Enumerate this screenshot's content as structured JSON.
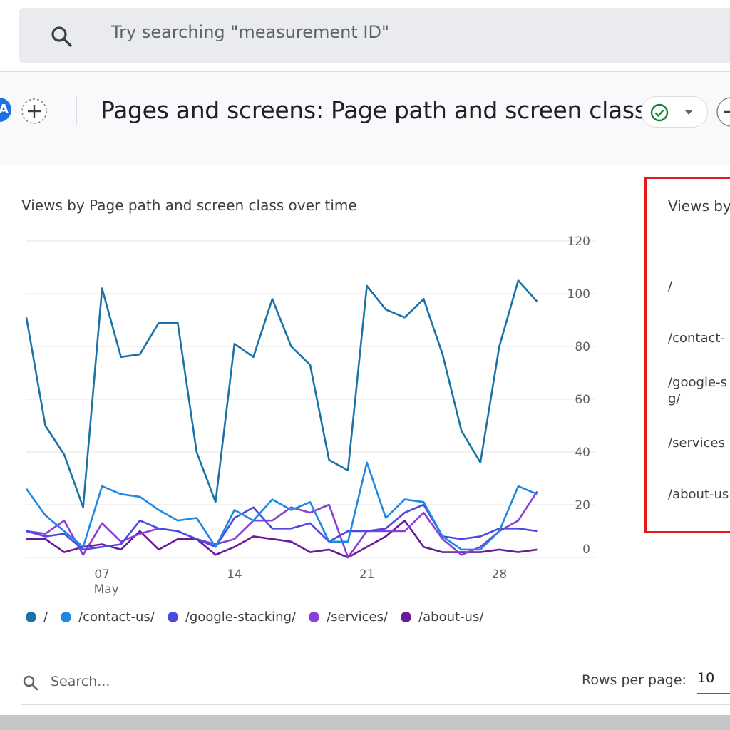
{
  "search": {
    "placeholder": "Try searching \"measurement ID\""
  },
  "header": {
    "avatar_letter": "A",
    "title": "Pages and screens: Page path and screen class"
  },
  "chart_card": {
    "title": "Views by Page path and screen class over time"
  },
  "chart_data": {
    "type": "line",
    "title": "Views by Page path and screen class over time",
    "x_tick_labels": [
      {
        "day": 7,
        "label": "07",
        "sub": "May"
      },
      {
        "day": 14,
        "label": "14",
        "sub": ""
      },
      {
        "day": 21,
        "label": "21",
        "sub": ""
      },
      {
        "day": 28,
        "label": "28",
        "sub": ""
      }
    ],
    "x": [
      3,
      4,
      5,
      6,
      7,
      8,
      9,
      10,
      11,
      12,
      13,
      14,
      15,
      16,
      17,
      18,
      19,
      20,
      21,
      22,
      23,
      24,
      25,
      26,
      27,
      28,
      29,
      30,
      31
    ],
    "xlim": [
      3,
      31
    ],
    "ylim": [
      0,
      120
    ],
    "y_ticks": [
      0,
      20,
      40,
      60,
      80,
      100,
      120
    ],
    "y_axis_position": "right",
    "grid": true,
    "legend_position": "bottom-left",
    "series": [
      {
        "name": "/",
        "color": "#1a73a8",
        "values": [
          91,
          50,
          39,
          19,
          102,
          76,
          77,
          89,
          89,
          40,
          21,
          81,
          76,
          98,
          80,
          73,
          37,
          33,
          103,
          94,
          91,
          98,
          77,
          48,
          36,
          80,
          105,
          97
        ]
      },
      {
        "name": "/contact-us/",
        "color": "#1e88e5",
        "values": [
          26,
          16,
          10,
          4,
          27,
          24,
          23,
          18,
          14,
          15,
          4,
          18,
          14,
          22,
          18,
          21,
          6,
          6,
          36,
          15,
          22,
          21,
          8,
          3,
          3,
          10,
          27,
          24
        ]
      },
      {
        "name": "/google-stacking/",
        "color": "#4a4ae0",
        "values": [
          10,
          8,
          9,
          3,
          4,
          5,
          14,
          11,
          10,
          7,
          4,
          15,
          19,
          11,
          11,
          13,
          6,
          10,
          10,
          11,
          17,
          20,
          8,
          7,
          8,
          11,
          11,
          10
        ]
      },
      {
        "name": "/services/",
        "color": "#8a3fd6",
        "values": [
          10,
          9,
          14,
          1,
          13,
          6,
          9,
          11,
          10,
          7,
          5,
          7,
          14,
          14,
          19,
          17,
          20,
          0,
          10,
          10,
          10,
          17,
          7,
          1,
          4,
          10,
          14,
          25
        ]
      },
      {
        "name": "/about-us/",
        "color": "#6a1b9a",
        "values": [
          7,
          7,
          2,
          4,
          5,
          3,
          10,
          3,
          7,
          7,
          1,
          4,
          8,
          7,
          6,
          2,
          3,
          0,
          4,
          8,
          14,
          4,
          2,
          2,
          2,
          3,
          2,
          3
        ]
      }
    ]
  },
  "right_panel": {
    "title": "Views by",
    "rows": [
      "/",
      "/contact-",
      "/google-s",
      "g/",
      "/services",
      "/about-us"
    ]
  },
  "table_toolbar": {
    "search_placeholder": "Search...",
    "rows_per_page_label": "Rows per page:",
    "rows_per_page_value": "10"
  }
}
